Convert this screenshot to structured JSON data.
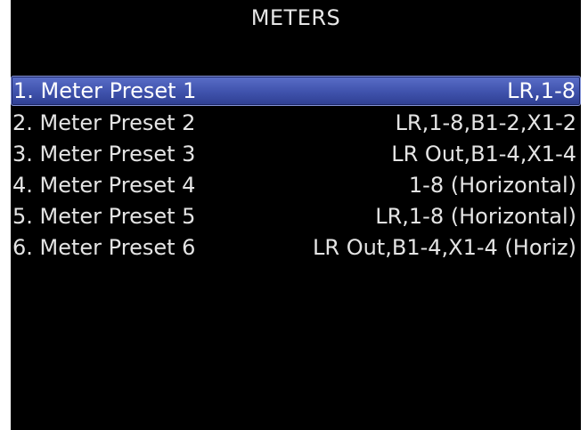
{
  "screen": {
    "title": "METERS"
  },
  "menu": {
    "selected_index": 0,
    "items": [
      {
        "label": "1. Meter Preset 1",
        "value": "LR,1-8"
      },
      {
        "label": "2. Meter Preset 2",
        "value": "LR,1-8,B1-2,X1-2"
      },
      {
        "label": "3. Meter Preset 3",
        "value": "LR Out,B1-4,X1-4"
      },
      {
        "label": "4. Meter Preset 4",
        "value": "1-8 (Horizontal)"
      },
      {
        "label": "5. Meter Preset 5",
        "value": "LR,1-8 (Horizontal)"
      },
      {
        "label": "6. Meter Preset 6",
        "value": "LR Out,B1-4,X1-4 (Horiz)"
      }
    ]
  },
  "colors": {
    "background": "#000000",
    "text": "#e4e4e4",
    "highlight": "#4a5cbf"
  }
}
